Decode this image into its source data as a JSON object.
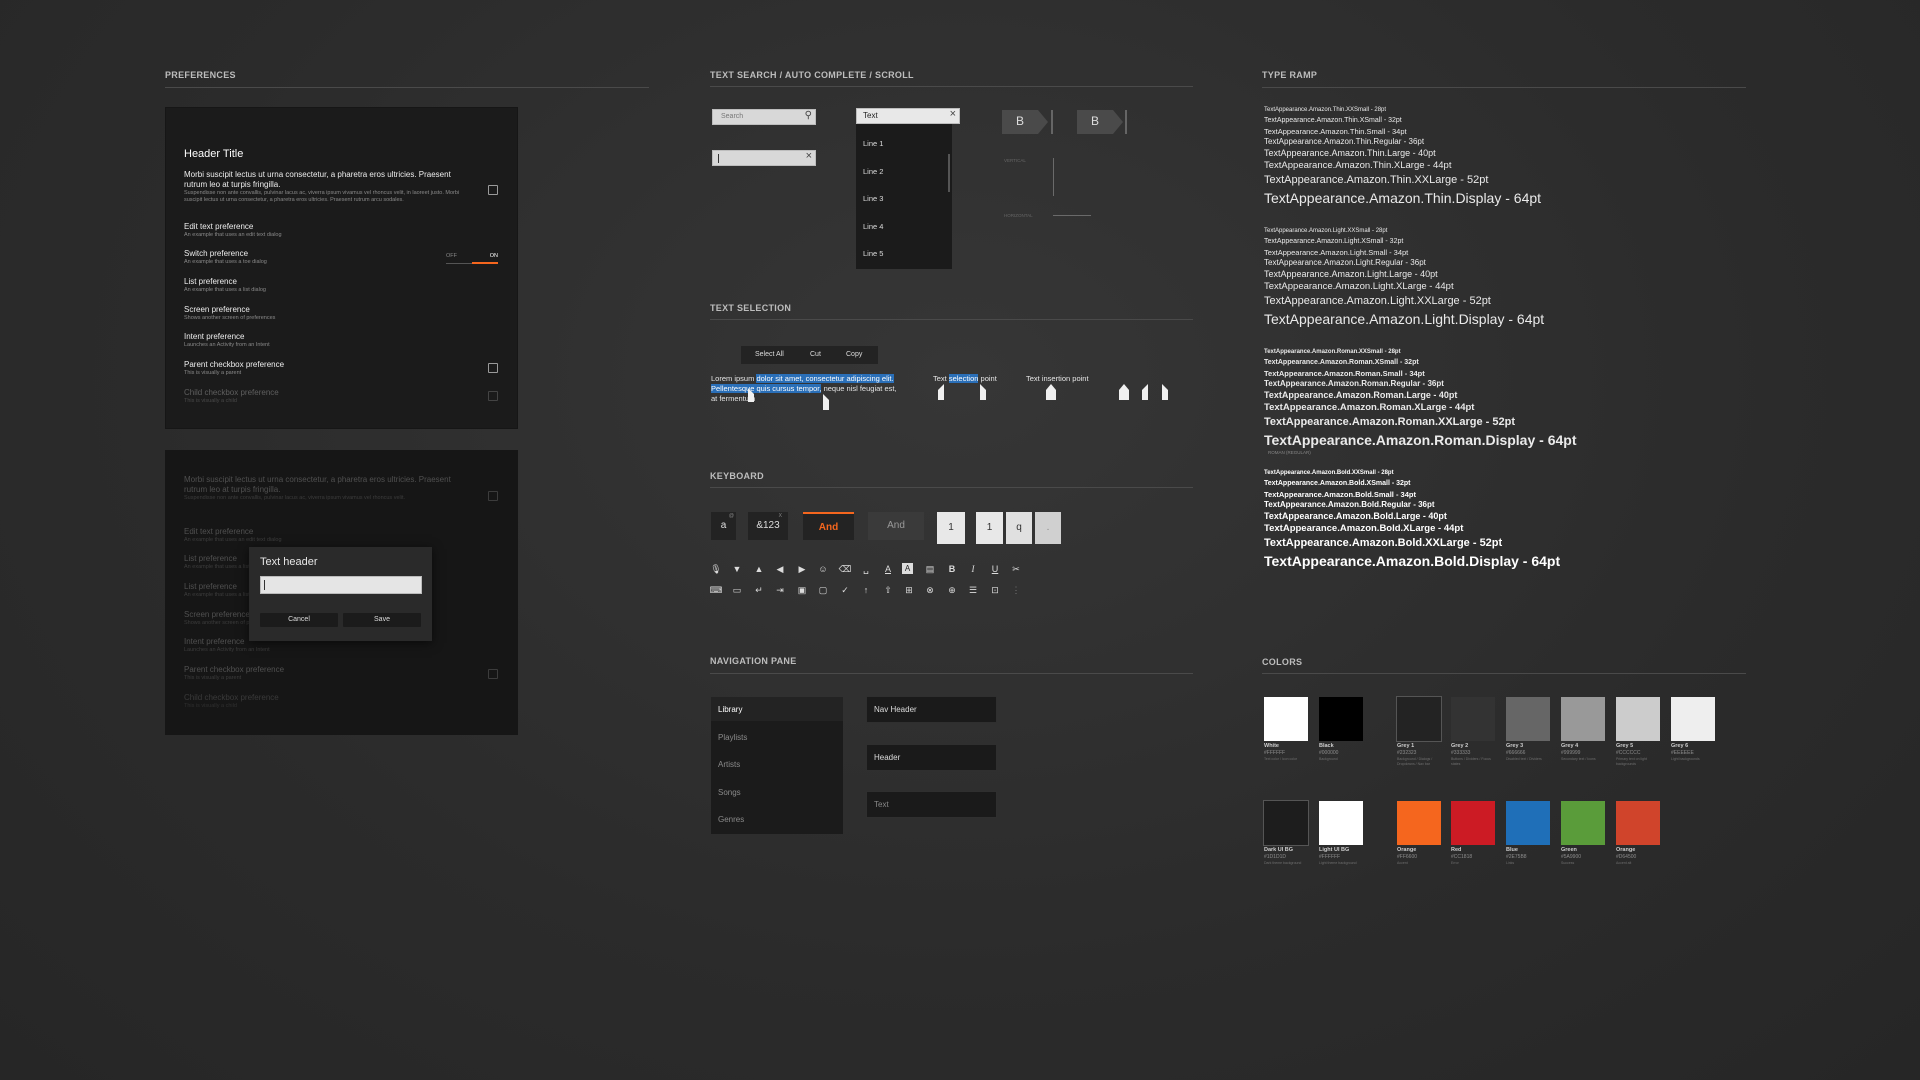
{
  "sections": {
    "preferences": "PREFERENCES",
    "text_search": "TEXT SEARCH / AUTO COMPLETE / SCROLL",
    "type_ramp": "TYPE RAMP",
    "text_selection": "TEXT SELECTION",
    "keyboard": "KEYBOARD",
    "navigation_pane": "NAVIGATION PANE",
    "colors": "COLORS"
  },
  "pref_panel": {
    "header_title": "Header Title",
    "items": [
      {
        "label": "Morbi suscipit lectus ut urna consectetur, a pharetra eros ultricies. Praesent rutrum leo at turpis fringilla.",
        "sub": "Suspendisse non ante convallis, pulvinar lacus ac, viverra ipsum vivamus vel rhoncus velit, in laoreet justo. Morbi suscipit lectus ut urna consectetur, a pharetra eros ultricies. Praesent rutrum arcu sodales."
      },
      {
        "label": "Edit text preference",
        "sub": "An example that uses an edit text dialog"
      },
      {
        "label": "Switch preference",
        "sub": "An example that uses a toe dialog"
      },
      {
        "label": "List preference",
        "sub": "An example that uses a list dialog"
      },
      {
        "label": "Screen preference",
        "sub": "Shows another screen of preferences"
      },
      {
        "label": "Intent preference",
        "sub": "Launches an Activity from an Intent"
      },
      {
        "label": "Parent checkbox preference",
        "sub": "This is visually a parent"
      },
      {
        "label": "Child checkbox preference",
        "sub": "This is visually a child"
      }
    ],
    "switch_off": "OFF",
    "switch_on": "ON"
  },
  "dim_panel": {
    "items": [
      {
        "label": "Morbi suscipit lectus ut urna consectetur, a pharetra eros ultricies. Praesent rutrum leo at turpis fringilla.",
        "sub": "Suspendisse non ante convallis, pulvinar lacus ac, viverra ipsum vivamus vel rhoncus velit."
      },
      {
        "label": "Edit text preference",
        "sub": "An example that uses an edit text dialog"
      },
      {
        "label": "List preference",
        "sub": "An example that uses a list dialog"
      },
      {
        "label": "List preference",
        "sub": "An example that uses a list dialog"
      },
      {
        "label": "Screen preference",
        "sub": "Shows another screen of preferences"
      },
      {
        "label": "Intent preference",
        "sub": "Launches an Activity from an Intent"
      },
      {
        "label": "Parent checkbox preference",
        "sub": "This is visually a parent"
      },
      {
        "label": "Child checkbox preference",
        "sub": "This is visually a child"
      }
    ],
    "dialog": {
      "title": "Text header",
      "cancel": "Cancel",
      "save": "Save"
    }
  },
  "text_search": {
    "search_placeholder": "Search",
    "autocomplete_value": "Text",
    "dropdown_items": [
      "Line 1",
      "Line 2",
      "Line 3",
      "Line 4",
      "Line 5"
    ],
    "tab_b1": "B",
    "tab_b2": "B",
    "vertical_label": "VERTICAL",
    "horizontal_label": "HORIZONTAL"
  },
  "text_selection": {
    "actions": [
      "Select All",
      "Cut",
      "Copy"
    ],
    "lorem_pre": "Lorem ipsum ",
    "lorem_sel1": "dolor sit amet, consectetur adipiscing elit.",
    "lorem_sel2": "Pellentesque quis cursus tempor,",
    "lorem_post": " neque nisl feugiat est,",
    "lorem_line3": "at fermentum",
    "sel_pre": "Text ",
    "sel_word": "selection",
    "sel_post": " point",
    "insertion": "Text insertion point"
  },
  "keyboard": {
    "key_a": "a",
    "key_a_hint": "@",
    "key_num": "&123",
    "key_num_hint": "X",
    "key_and_active": "And",
    "key_and": "And",
    "key_1a": "1",
    "key_1b": "1",
    "key_q": "q",
    "key_dot": ".",
    "icons_row1": [
      "mic-icon",
      "caret-down-icon",
      "caret-up-icon",
      "caret-left-icon",
      "caret-right-icon",
      "emoji-icon",
      "backspace-icon",
      "space-icon",
      "text-color-icon",
      "highlight-icon",
      "clipboard-icon",
      "bold-icon",
      "italic-icon",
      "underline-icon",
      "cut-icon"
    ],
    "glyphs_row1": [
      "🎙",
      "▼",
      "▲",
      "◀",
      "▶",
      "☺",
      "⌫",
      "␣",
      "A",
      "A",
      "▤",
      "B",
      "I",
      "U",
      "✂"
    ],
    "icons_row2": [
      "keyboard-hide-icon",
      "keyboard-icon",
      "return-icon",
      "tab-icon",
      "keyboard-switch-icon",
      "keyboard-small-icon",
      "check-icon",
      "shift-icon",
      "upload-icon",
      "plus-box-icon",
      "close-circle-icon",
      "add-circle-icon",
      "list-icon",
      "text-box-icon",
      "dots-icon"
    ],
    "glyphs_row2": [
      "⌨",
      "▭",
      "↵",
      "⇥",
      "▣",
      "▢",
      "✓",
      "↑",
      "⇧",
      "⊞",
      "⊗",
      "⊕",
      "☰",
      "⊡",
      "⋮"
    ]
  },
  "navigation": {
    "items": [
      "Library",
      "Playlists",
      "Artists",
      "Songs",
      "Genres"
    ],
    "nav_header": "Nav Header",
    "header": "Header",
    "text": "Text"
  },
  "type_ramp": {
    "thin": [
      "TextAppearance.Amazon.Thin.XXSmall - 28pt",
      "TextAppearance.Amazon.Thin.XSmall - 32pt",
      "TextAppearance.Amazon.Thin.Small - 34pt",
      "TextAppearance.Amazon.Thin.Regular - 36pt",
      "TextAppearance.Amazon.Thin.Large - 40pt",
      "TextAppearance.Amazon.Thin.XLarge - 44pt",
      "TextAppearance.Amazon.Thin.XXLarge - 52pt",
      "TextAppearance.Amazon.Thin.Display - 64pt"
    ],
    "light": [
      "TextAppearance.Amazon.Light.XXSmall - 28pt",
      "TextAppearance.Amazon.Light.XSmall - 32pt",
      "TextAppearance.Amazon.Light.Small - 34pt",
      "TextAppearance.Amazon.Light.Regular - 36pt",
      "TextAppearance.Amazon.Light.Large - 40pt",
      "TextAppearance.Amazon.Light.XLarge - 44pt",
      "TextAppearance.Amazon.Light.XXLarge - 52pt",
      "TextAppearance.Amazon.Light.Display - 64pt"
    ],
    "roman": [
      "TextAppearance.Amazon.Roman.XXSmall - 28pt",
      "TextAppearance.Amazon.Roman.XSmall - 32pt",
      "TextAppearance.Amazon.Roman.Small - 34pt",
      "TextAppearance.Amazon.Roman.Regular - 36pt",
      "TextAppearance.Amazon.Roman.Large - 40pt",
      "TextAppearance.Amazon.Roman.XLarge - 44pt",
      "TextAppearance.Amazon.Roman.XXLarge - 52pt",
      "TextAppearance.Amazon.Roman.Display - 64pt"
    ],
    "roman_note": "ROMAN (REGULAR)",
    "bold": [
      "TextAppearance.Amazon.Bold.XXSmall - 28pt",
      "TextAppearance.Amazon.Bold.XSmall - 32pt",
      "TextAppearance.Amazon.Bold.Small - 34pt",
      "TextAppearance.Amazon.Bold.Regular - 36pt",
      "TextAppearance.Amazon.Bold.Large - 40pt",
      "TextAppearance.Amazon.Bold.XLarge - 44pt",
      "TextAppearance.Amazon.Bold.XXLarge - 52pt",
      "TextAppearance.Amazon.Bold.Display - 64pt"
    ]
  },
  "colors": {
    "row1": [
      {
        "name": "White",
        "hex": "#FFFFFF",
        "color": "#ffffff",
        "desc": "Text color / Icon color"
      },
      {
        "name": "Black",
        "hex": "#000000",
        "color": "#000000",
        "desc": "Background"
      },
      {
        "name": "Grey 1",
        "hex": "#232323",
        "color": "#232323",
        "desc": "Background / Dialogs / Dropdowns / Nav bar"
      },
      {
        "name": "Grey 2",
        "hex": "#333333",
        "color": "#333333",
        "desc": "Buttons / Dividers / Focus states"
      },
      {
        "name": "Grey 3",
        "hex": "#666666",
        "color": "#666666",
        "desc": "Disabled text / Dividers"
      },
      {
        "name": "Grey 4",
        "hex": "#999999",
        "color": "#999999",
        "desc": "Secondary text / Icons"
      },
      {
        "name": "Grey 5",
        "hex": "#CCCCCC",
        "color": "#cccccc",
        "desc": "Primary text on light backgrounds"
      },
      {
        "name": "Grey 6",
        "hex": "#EEEEEE",
        "color": "#eeeeee",
        "desc": "Light backgrounds"
      }
    ],
    "row2": [
      {
        "name": "Dark UI BG",
        "hex": "#1D1D1D",
        "color": "#1d1d1d",
        "desc": "Dark theme background"
      },
      {
        "name": "Light UI BG",
        "hex": "#FFFFFF",
        "color": "#ffffff",
        "desc": "Light theme background"
      },
      {
        "name": "Orange",
        "hex": "#FF6600",
        "color": "#f5661e",
        "desc": "Accent"
      },
      {
        "name": "Red",
        "hex": "#CC1818",
        "color": "#cc1b24",
        "desc": "Error"
      },
      {
        "name": "Blue",
        "hex": "#2E75B8",
        "color": "#1f6fb8",
        "desc": "Links"
      },
      {
        "name": "Green",
        "hex": "#5A9900",
        "color": "#5a9c3a",
        "desc": "Success"
      },
      {
        "name": "Orange",
        "hex": "#D64500",
        "color": "#d0442b",
        "desc": "Accent alt"
      }
    ]
  }
}
